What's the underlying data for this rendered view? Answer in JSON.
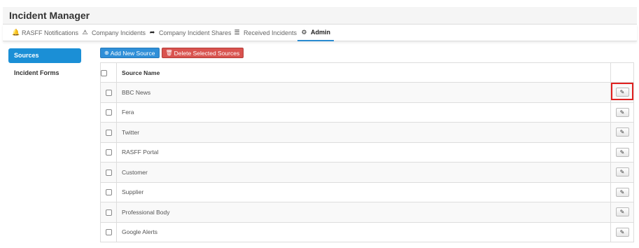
{
  "app": {
    "title": "Incident Manager"
  },
  "tabs": [
    {
      "label": "RASFF Notifications",
      "icon": "bell-icon",
      "glyph": "🔔"
    },
    {
      "label": "Company Incidents",
      "icon": "warning-icon",
      "glyph": "⚠"
    },
    {
      "label": "Company Incident Shares",
      "icon": "share-icon",
      "glyph": "➦"
    },
    {
      "label": "Received Incidents",
      "icon": "list-icon",
      "glyph": "☰"
    },
    {
      "label": "Admin",
      "icon": "gear-icon",
      "glyph": "⚙"
    }
  ],
  "sidebar": {
    "items": [
      {
        "label": "Sources",
        "active": true
      },
      {
        "label": "Incident Forms",
        "active": false
      }
    ]
  },
  "toolbar": {
    "add_label": "Add New Source",
    "add_icon": "plus-circle-icon",
    "delete_label": "Delete Selected Sources",
    "delete_icon": "trash-icon"
  },
  "table": {
    "header": "Source Name",
    "rows": [
      "BBC News",
      "Fera",
      "Twitter",
      "RASFF Portal",
      "Customer",
      "Supplier",
      "Professional Body",
      "Google Alerts"
    ]
  },
  "colors": {
    "accent": "#1b8fd6",
    "danger": "#d9534f",
    "highlight": "#e0201f"
  }
}
